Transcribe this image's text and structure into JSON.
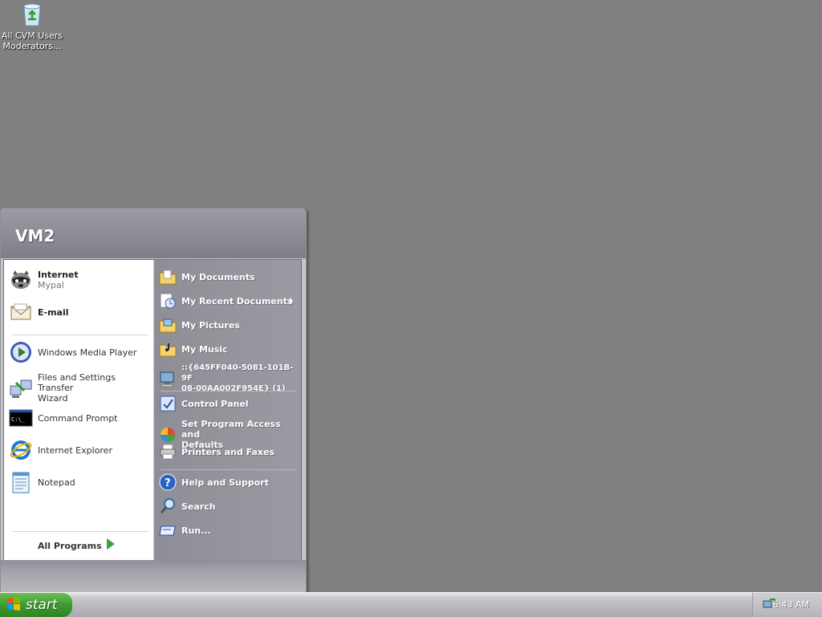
{
  "desktop": {
    "icons": [
      {
        "label_line1": "All CVM Users",
        "label_line2": "Moderators...",
        "icon": "recycle-folder-icon"
      }
    ]
  },
  "start_menu": {
    "user_name": "VM2",
    "pinned": [
      {
        "main": "Internet",
        "sub": "Mypal",
        "icon": "raccoon-browser-icon"
      },
      {
        "main": "E-mail",
        "sub": "",
        "icon": "envelope-icon"
      }
    ],
    "recent": [
      {
        "label": "Windows Media Player",
        "icon": "media-player-icon"
      },
      {
        "label": "Files and Settings Transfer",
        "label2": "Wizard",
        "icon": "transfer-wizard-icon"
      },
      {
        "label": "Command Prompt",
        "icon": "command-prompt-icon"
      },
      {
        "label": "Internet Explorer",
        "icon": "internet-explorer-icon"
      },
      {
        "label": "Notepad",
        "icon": "notepad-icon"
      }
    ],
    "all_programs": "All Programs",
    "places": [
      {
        "label": "My Documents",
        "icon": "folder-documents-icon"
      },
      {
        "label": "My Recent Documents",
        "icon": "recent-documents-icon",
        "has_submenu": true
      },
      {
        "label": "My Pictures",
        "icon": "folder-pictures-icon"
      },
      {
        "label": "My Music",
        "icon": "folder-music-icon"
      },
      {
        "label": "::{645FF040-5081-101B-9F",
        "label2": "08-00AA002F954E} (1)",
        "icon": "computer-icon"
      }
    ],
    "settings": [
      {
        "label": "Control Panel",
        "icon": "control-panel-icon"
      },
      {
        "label": "Set Program Access and",
        "label2": "Defaults",
        "icon": "program-access-icon"
      },
      {
        "label": "Printers and Faxes",
        "icon": "printer-icon"
      }
    ],
    "tools": [
      {
        "label": "Help and Support",
        "icon": "help-icon"
      },
      {
        "label": "Search",
        "icon": "search-icon"
      },
      {
        "label": "Run...",
        "icon": "run-icon"
      }
    ]
  },
  "taskbar": {
    "start_label": "start",
    "clock": "6:43 AM"
  },
  "colors": {
    "desktop_bg": "#808080",
    "start_green": "#3d9a2f",
    "menu_right_bg": "#9a9aa2"
  }
}
